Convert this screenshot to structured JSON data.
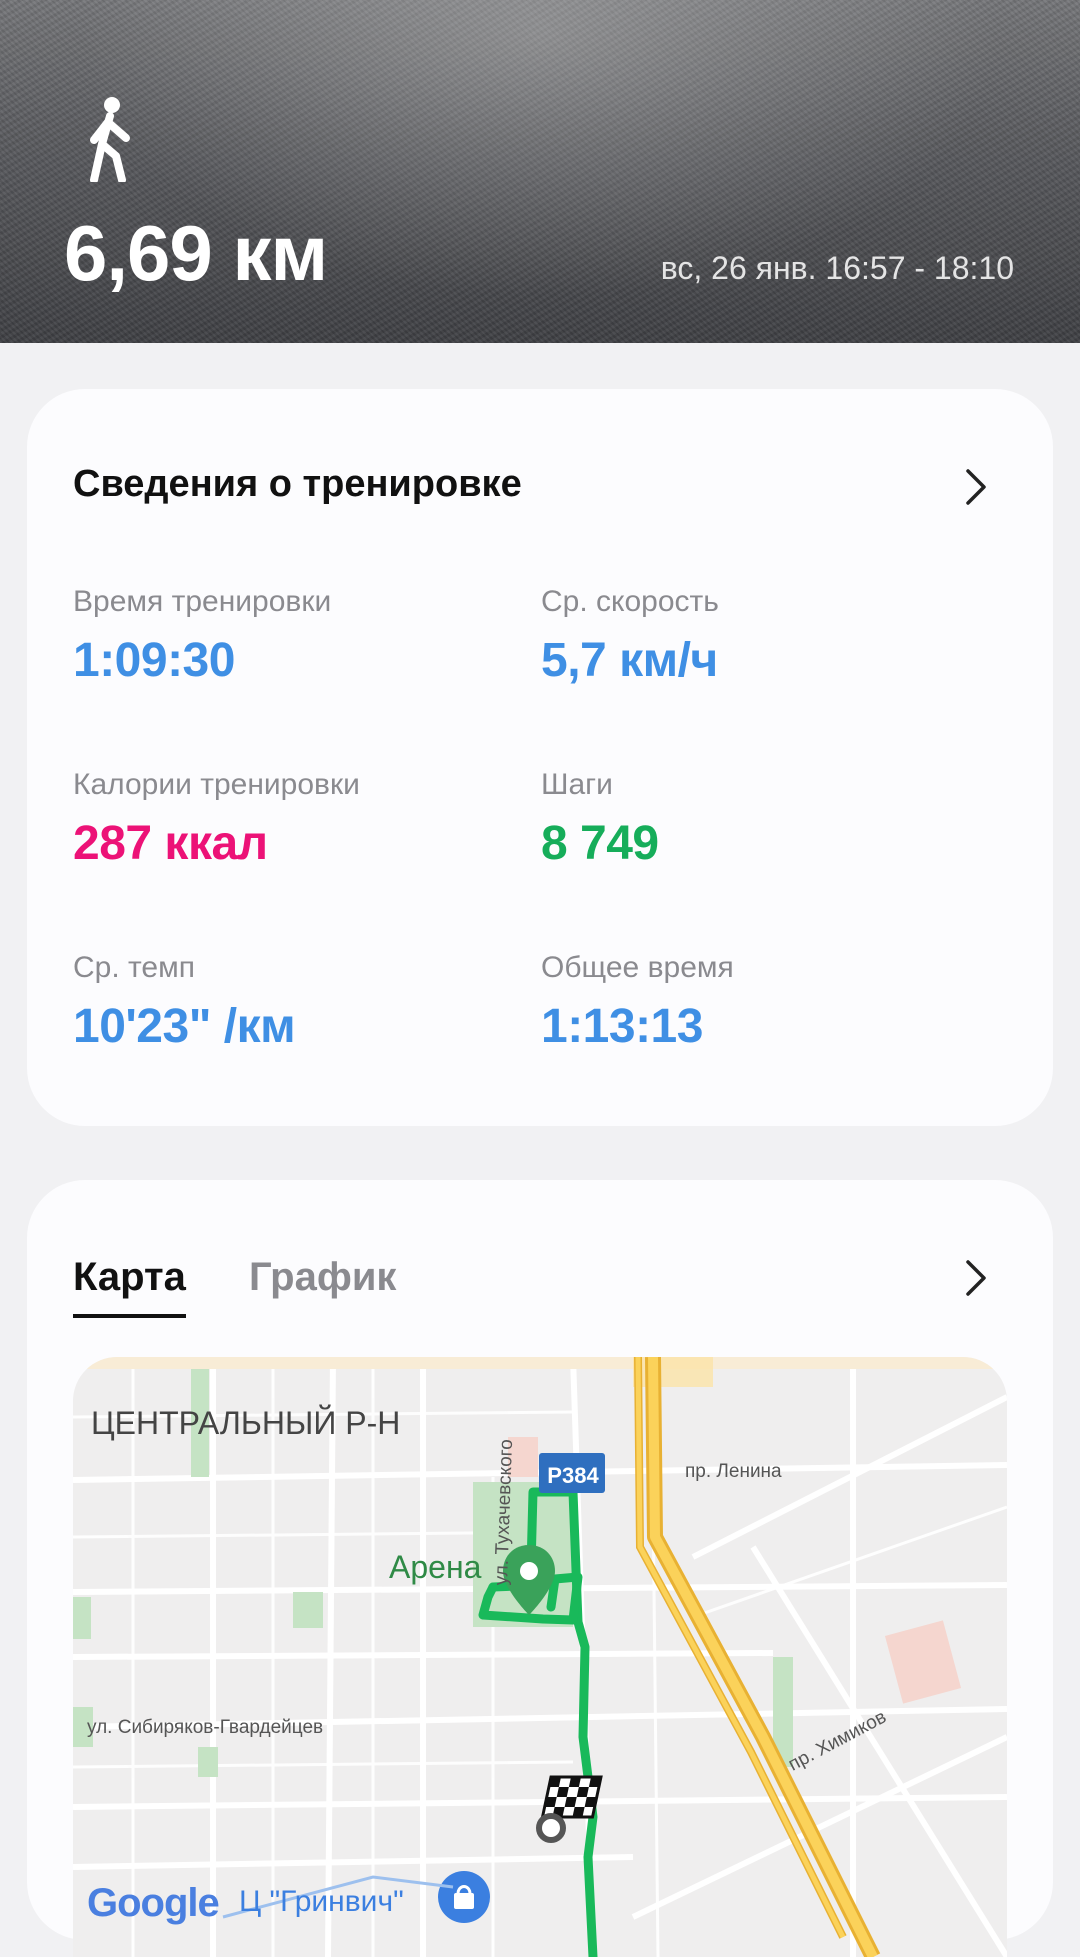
{
  "header": {
    "activity_icon": "walking-person-icon",
    "distance": "6,69 км",
    "datetime": "вс, 26 янв. 16:57 - 18:10"
  },
  "workout_details": {
    "title": "Сведения о тренировке",
    "stats": [
      {
        "label": "Время тренировки",
        "value": "1:09:30",
        "color": "#3f8fe4"
      },
      {
        "label": "Ср. скорость",
        "value": "5,7 км/ч",
        "color": "#3f8fe4"
      },
      {
        "label": "Калории тренировки",
        "value": "287 ккал",
        "color": "#ec1277"
      },
      {
        "label": "Шаги",
        "value": "8 749",
        "color": "#16ad5a"
      },
      {
        "label": "Ср. темп",
        "value": "10'23\" /км",
        "color": "#3f8fe4"
      },
      {
        "label": "Общее время",
        "value": "1:13:13",
        "color": "#3f8fe4"
      }
    ]
  },
  "map_section": {
    "tabs": [
      {
        "label": "Карта",
        "active": true
      },
      {
        "label": "График",
        "active": false
      }
    ],
    "map": {
      "district": "ЦЕНТРАЛЬНЫЙ Р-Н",
      "route_badge": "Р384",
      "streets": {
        "lenin": "пр. Ленина",
        "tukhachevsky": "ул. Тухачевского",
        "sibiryakov": "ул. Сибиряков-Гвардейцев",
        "khimikov": "пр. Химиков"
      },
      "poi_arena": "Арена",
      "poi_shop": "Ц \"Гринвич\"",
      "logo": "Google",
      "route_color": "#19b95a"
    }
  }
}
